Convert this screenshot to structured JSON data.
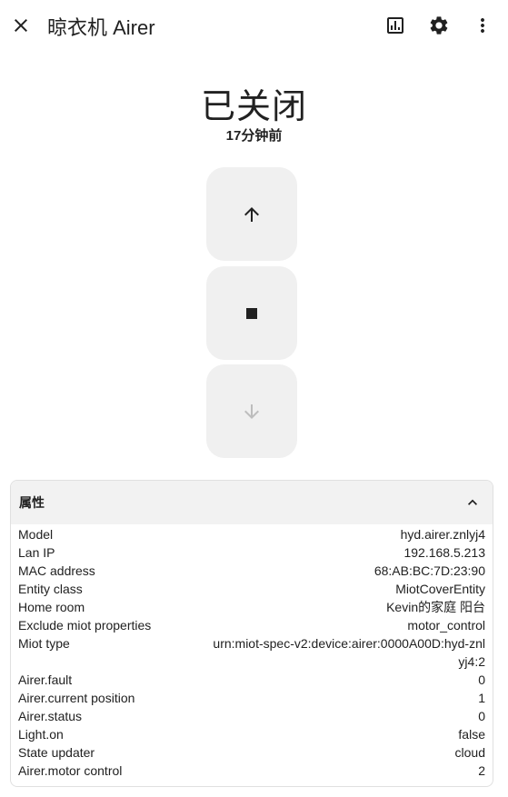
{
  "header": {
    "title": "晾衣机 Airer",
    "close_icon": "close-icon",
    "history_icon": "chart-box-icon",
    "settings_icon": "gear-icon",
    "more_icon": "dots-vertical-icon"
  },
  "state": {
    "value": "已关闭",
    "last_changed": "17分钟前"
  },
  "controls": {
    "up_icon": "arrow-up-icon",
    "stop_icon": "stop-icon",
    "down_icon": "arrow-down-icon",
    "down_disabled": true
  },
  "attributes": {
    "title": "属性",
    "expanded": true,
    "rows": [
      {
        "key": "Model",
        "value": "hyd.airer.znlyj4"
      },
      {
        "key": "Lan IP",
        "value": "192.168.5.213"
      },
      {
        "key": "MAC address",
        "value": "68:AB:BC:7D:23:90"
      },
      {
        "key": "Entity class",
        "value": "MiotCoverEntity"
      },
      {
        "key": "Home room",
        "value": "Kevin的家庭 阳台"
      },
      {
        "key": "Exclude miot properties",
        "value": "motor_control"
      },
      {
        "key": "Miot type",
        "value": "urn:miot-spec-v2:device:airer:0000A00D:hyd-znlyj4:2"
      },
      {
        "key": "Airer.fault",
        "value": "0"
      },
      {
        "key": "Airer.current position",
        "value": "1"
      },
      {
        "key": "Airer.status",
        "value": "0"
      },
      {
        "key": "Light.on",
        "value": "false"
      },
      {
        "key": "State updater",
        "value": "cloud"
      },
      {
        "key": "Airer.motor control",
        "value": "2"
      }
    ]
  },
  "colors": {
    "text": "#212121",
    "button_bg": "#f0f0f0",
    "disabled_icon": "#bdbdbd",
    "panel_header_bg": "#f2f2f2",
    "panel_border": "#e0e0e0"
  }
}
